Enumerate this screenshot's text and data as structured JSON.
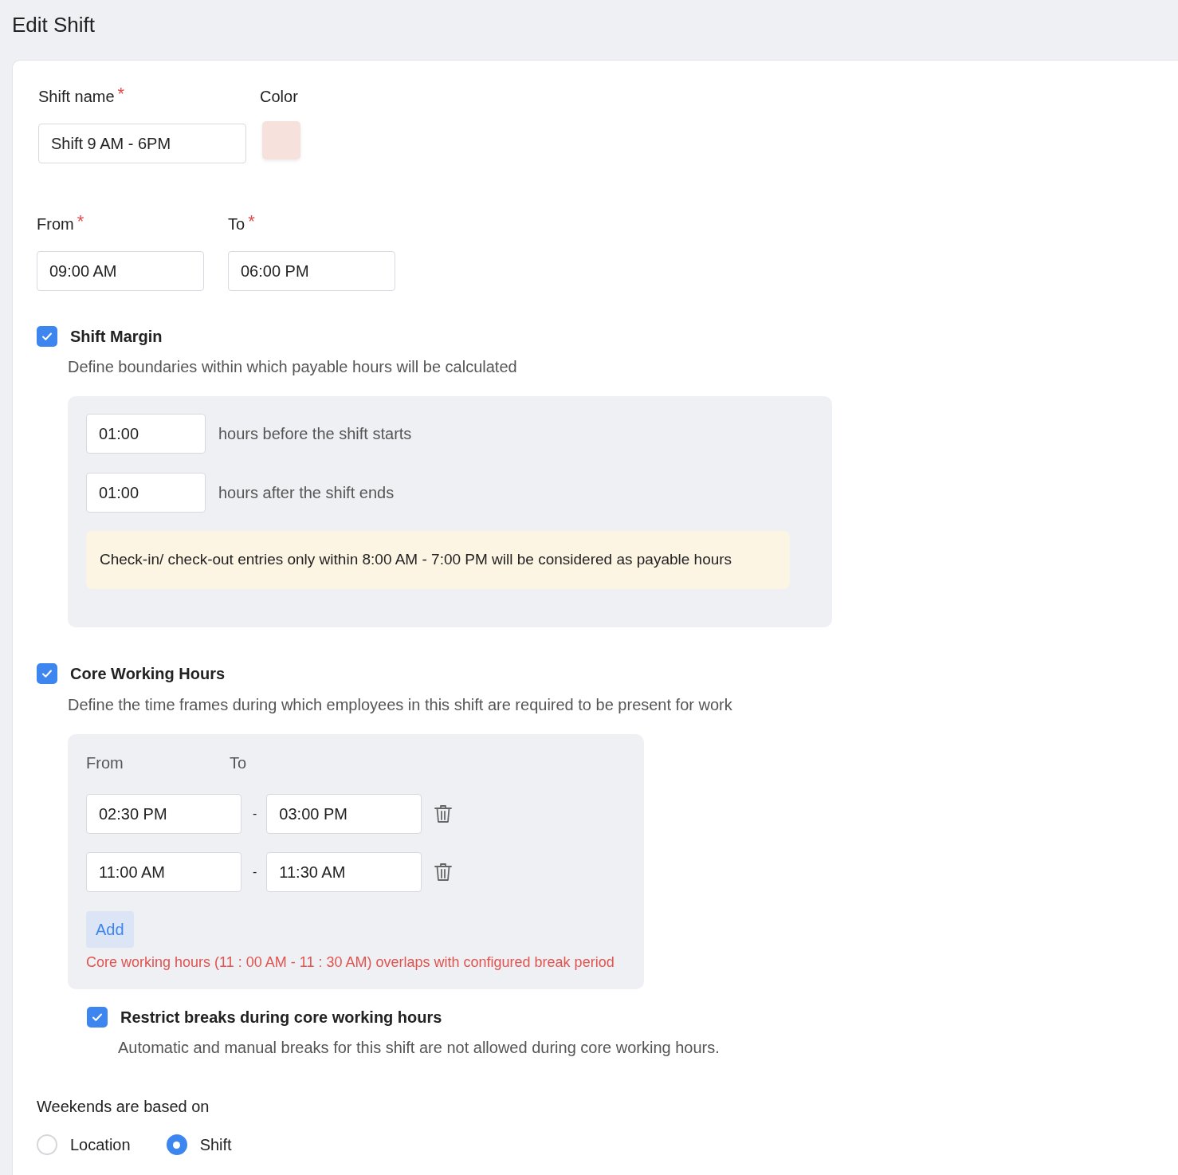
{
  "page_title": "Edit Shift",
  "shift_name": {
    "label": "Shift name",
    "required_mark": "*",
    "value": "Shift 9 AM - 6PM"
  },
  "color": {
    "label": "Color",
    "color": "#f7e1dc"
  },
  "from": {
    "label": "From",
    "required_mark": "*",
    "value": "09:00 AM"
  },
  "to": {
    "label": "To",
    "required_mark": "*",
    "value": "06:00 PM"
  },
  "shift_margin": {
    "checked": true,
    "title": "Shift Margin",
    "description": "Define boundaries within which payable hours will be calculated",
    "rows": [
      {
        "value": "01:00",
        "text": "hours before the shift starts"
      },
      {
        "value": "01:00",
        "text": "hours after the shift ends"
      }
    ],
    "notice": "Check-in/ check-out entries only within 8:00 AM - 7:00 PM will be considered as payable hours"
  },
  "core_hours": {
    "checked": true,
    "title": "Core Working Hours",
    "description": "Define the time frames during which employees in this shift are required to be present for work",
    "from_label": "From",
    "to_label": "To",
    "ranges": [
      {
        "from": "02:30 PM",
        "separator": "-",
        "to": "03:00 PM"
      },
      {
        "from": "11:00 AM",
        "separator": "-",
        "to": "11:30 AM"
      }
    ],
    "add_button": "Add",
    "error": "Core working hours (11 : 00 AM - 11 : 30 AM) overlaps with configured break period"
  },
  "restrict_breaks": {
    "checked": true,
    "title": "Restrict breaks during core working hours",
    "description": "Automatic and manual breaks for this shift are not allowed during core working hours."
  },
  "weekends": {
    "label": "Weekends are based on",
    "options": [
      {
        "label": "Location",
        "selected": false
      },
      {
        "label": "Shift",
        "selected": true
      }
    ]
  }
}
